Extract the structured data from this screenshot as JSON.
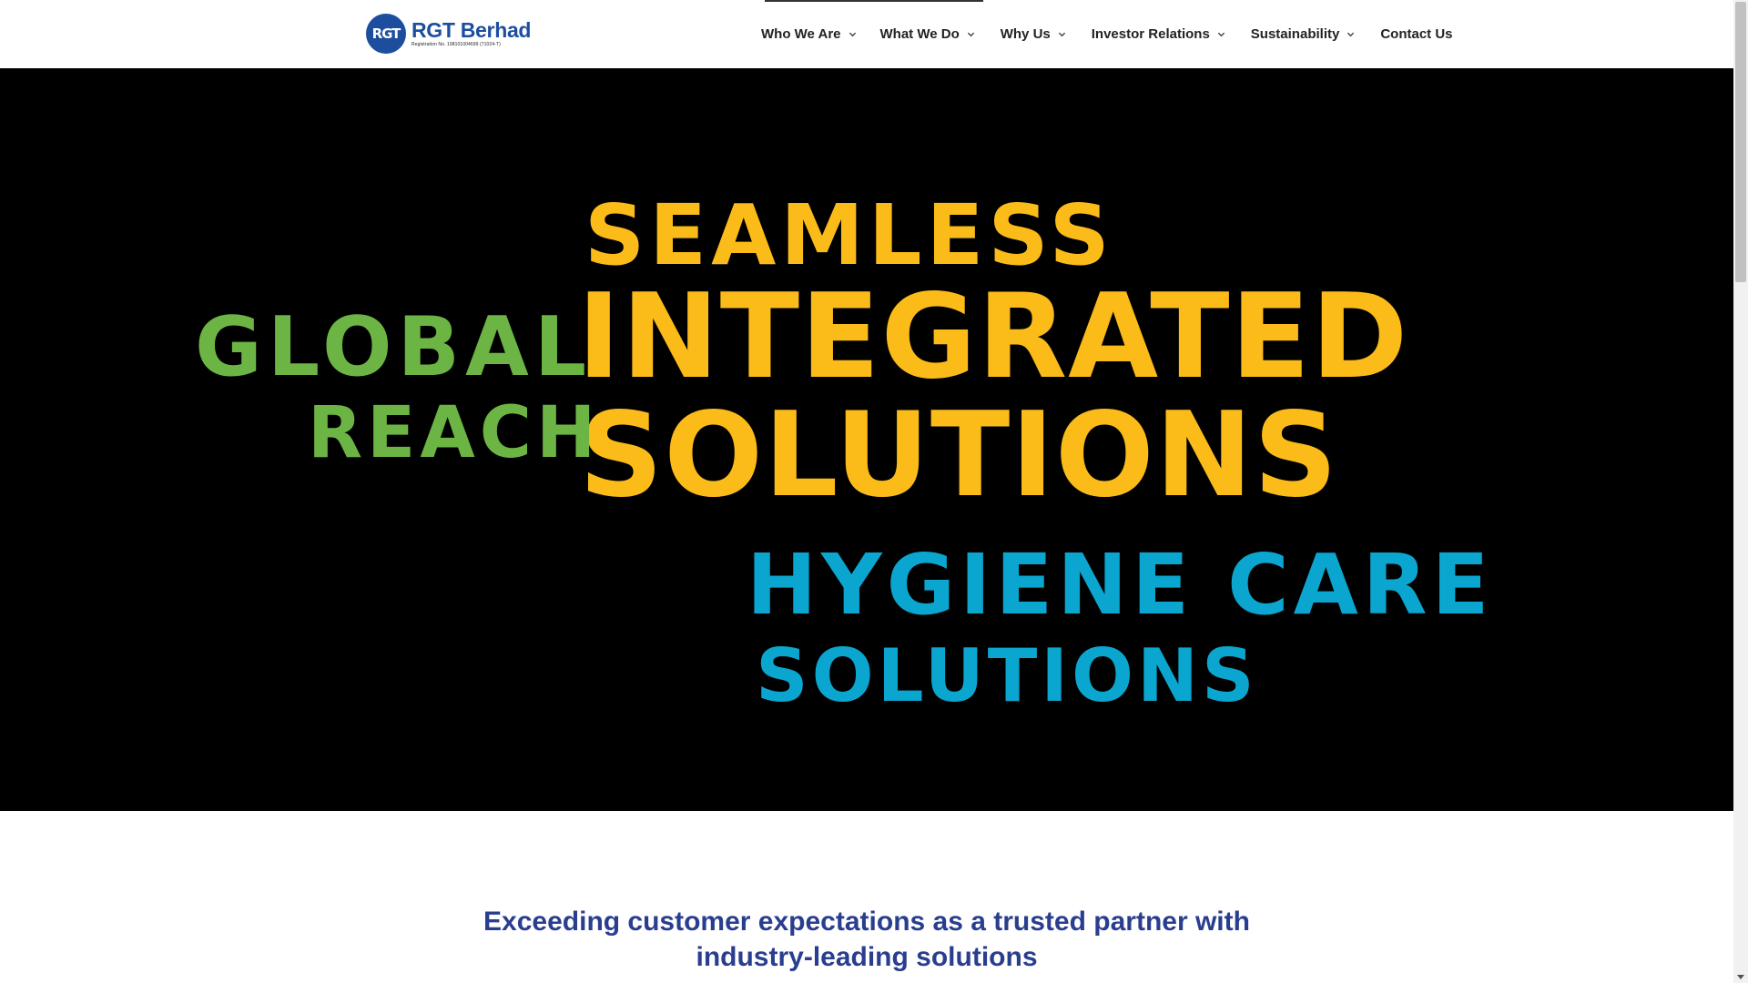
{
  "header": {
    "logo_mark": "RGT",
    "logo_name": "RGT Berhad",
    "logo_registration": "Registration No. 198101004699 (71024-T)",
    "brand_color": "#1d4e9e"
  },
  "nav": {
    "items": [
      {
        "label": "Who We Are",
        "has_dropdown": true
      },
      {
        "label": "What We Do",
        "has_dropdown": true
      },
      {
        "label": "Why Us",
        "has_dropdown": true
      },
      {
        "label": "Investor Relations",
        "has_dropdown": true
      },
      {
        "label": "Sustainability",
        "has_dropdown": true
      },
      {
        "label": "Contact Us",
        "has_dropdown": false
      }
    ],
    "dropdown_icon": "chevron-down-icon"
  },
  "hero": {
    "background": "#000000",
    "words": {
      "seamless": "SEAMLESS",
      "integrated": "INTEGRATED",
      "solutions_primary": "SOLUTIONS",
      "global": "GLOBAL",
      "reach": "REACH",
      "hygiene_care": "HYGIENE CARE",
      "solutions_secondary": "SOLUTIONS"
    },
    "colors": {
      "yellow": "#fbbb19",
      "green": "#6cb544",
      "blue": "#0aa6cf"
    }
  },
  "tagline": {
    "line1": "Exceeding customer expectations as a trusted partner with",
    "line2": "industry-leading solutions",
    "color": "#2a3e8f"
  }
}
